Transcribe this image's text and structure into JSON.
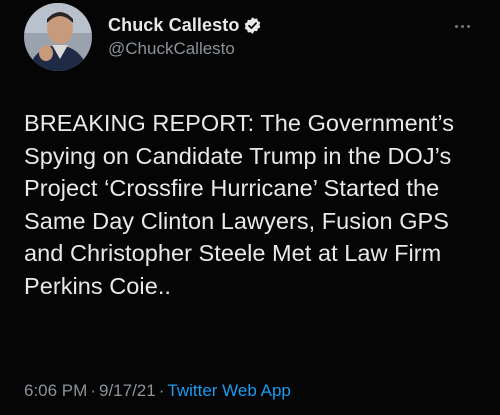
{
  "author": {
    "display_name": "Chuck Callesto",
    "handle": "@ChuckCallesto",
    "verified": true,
    "avatar_icon": "profile-photo"
  },
  "tweet": {
    "text": "BREAKING REPORT: The Government’s Spying on Candidate Trump in the DOJ’s Project ‘Crossfire Hurricane’ Started the Same Day Clinton Lawyers, Fusion GPS and Christopher Steele Met at Law Firm Perkins Coie..",
    "time": "6:06 PM",
    "date": "9/17/21",
    "separator": "·",
    "source": "Twitter Web App"
  },
  "colors": {
    "background": "#050505",
    "text": "#e7e9ea",
    "secondary": "#8b9299",
    "accent": "#1d9bf0"
  }
}
